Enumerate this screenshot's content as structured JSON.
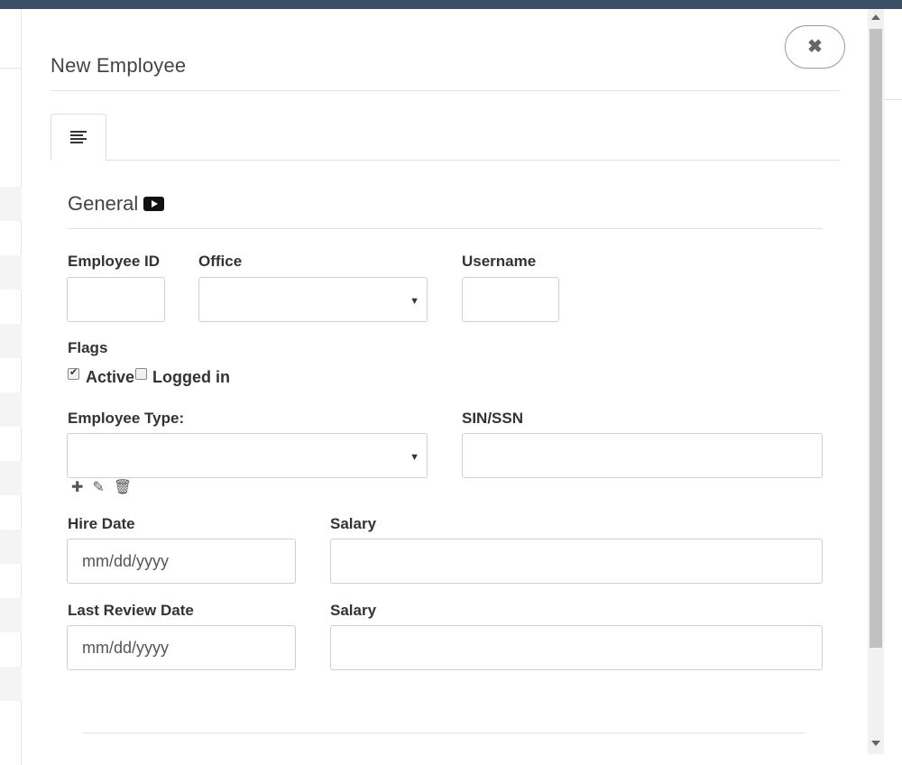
{
  "modal": {
    "title": "New Employee",
    "close_icon": "✖",
    "tab_icon": "align-left-icon"
  },
  "section": {
    "title": "General",
    "video_icon": "youtube-play-icon"
  },
  "fields": {
    "employee_id": {
      "label": "Employee ID",
      "value": ""
    },
    "office": {
      "label": "Office",
      "value": ""
    },
    "username": {
      "label": "Username",
      "value": ""
    },
    "flags": {
      "label": "Flags",
      "active": {
        "label": "Active",
        "checked": true
      },
      "logged_in": {
        "label": "Logged in",
        "checked": false
      }
    },
    "employee_type": {
      "label": "Employee Type:",
      "value": ""
    },
    "sin_ssn": {
      "label": "SIN/SSN",
      "value": ""
    },
    "hire_date": {
      "label": "Hire Date",
      "placeholder": "mm/dd/yyyy"
    },
    "hire_salary": {
      "label": "Salary",
      "value": ""
    },
    "last_review_date": {
      "label": "Last Review Date",
      "placeholder": "mm/dd/yyyy"
    },
    "review_salary": {
      "label": "Salary",
      "value": ""
    }
  },
  "type_tools": {
    "add": "✚",
    "edit": "✎",
    "delete": "🗑"
  },
  "colors": {
    "topbar": "#3b4e63",
    "border": "#cfcfcf"
  }
}
